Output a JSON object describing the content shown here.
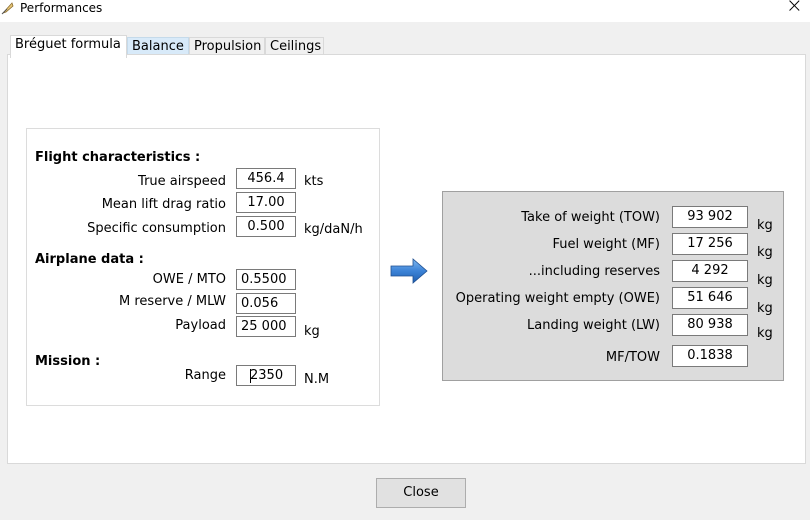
{
  "window": {
    "title": "Performances",
    "close_glyph": "×",
    "app_icon": "feather-icon"
  },
  "tabs": [
    {
      "label": "Bréguet formula",
      "active": true
    },
    {
      "label": "Balance",
      "active": false
    },
    {
      "label": "Propulsion",
      "active": false
    },
    {
      "label": "Ceilings",
      "active": false
    }
  ],
  "flight_characteristics": {
    "title": "Flight characteristics :",
    "true_airspeed": {
      "label": "True airspeed",
      "value": "456.4",
      "unit": "kts"
    },
    "lift_drag": {
      "label": "Mean lift drag ratio",
      "value": "17.00",
      "unit": ""
    },
    "consumption": {
      "label": "Specific consumption",
      "value": "0.500",
      "unit": "kg/daN/h"
    }
  },
  "airplane_data": {
    "title": "Airplane data :",
    "owe_mto": {
      "label": "OWE / MTO",
      "value": "0.5500"
    },
    "m_reserve": {
      "label": "M reserve / MLW",
      "value": "0.056"
    },
    "payload": {
      "label": "Payload",
      "value": "25 000",
      "unit": "kg"
    }
  },
  "mission": {
    "title": "Mission :",
    "range": {
      "label": "Range",
      "value": "2350",
      "unit": "N.M"
    }
  },
  "results": {
    "tow": {
      "label": "Take of weight (TOW)",
      "value": "93 902",
      "unit": "kg"
    },
    "mf": {
      "label": "Fuel weight (MF)",
      "value": "17 256",
      "unit": "kg"
    },
    "reserves": {
      "label": "...including reserves",
      "value": "4 292",
      "unit": "kg"
    },
    "owe": {
      "label": "Operating weight empty (OWE)",
      "value": "51 646",
      "unit": "kg"
    },
    "lw": {
      "label": "Landing weight (LW)",
      "value": "80 938",
      "unit": "kg"
    },
    "mf_tow": {
      "label": "MF/TOW",
      "value": "0.1838"
    }
  },
  "buttons": {
    "close_label": "Close"
  },
  "colors": {
    "arrow": "#3b82d6",
    "result_panel": "#dcdcdc"
  }
}
